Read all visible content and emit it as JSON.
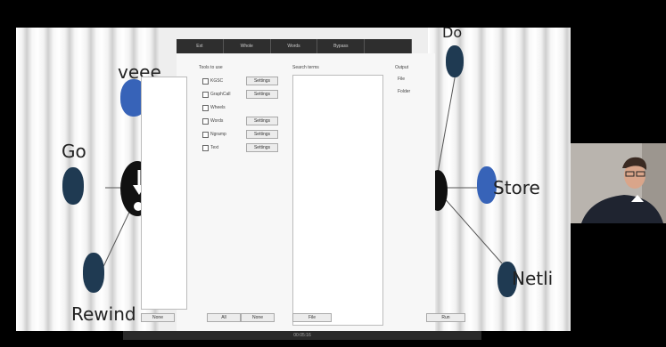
{
  "topbar_tabs": [
    "Ext",
    "Whole",
    "Words",
    "Bypass",
    ""
  ],
  "tools_header": "Tools to use",
  "tools": [
    {
      "name": "KGSC",
      "settings": "Settings"
    },
    {
      "name": "GraphCall",
      "settings": "Settings"
    },
    {
      "name": "Wheels",
      "settings": ""
    },
    {
      "name": "Words",
      "settings": "Settings"
    },
    {
      "name": "Ngramp",
      "settings": "Settings"
    },
    {
      "name": "Text",
      "settings": "Settings"
    }
  ],
  "search_header": "Search terms",
  "output_header": "Output",
  "output_labels": [
    "File",
    "Folder"
  ],
  "bottom_buttons": {
    "none_left": "None",
    "all": "All",
    "none_mid": "None",
    "file": "File",
    "run": "Run"
  },
  "mindmap_words": {
    "veee": "veee",
    "go": "Go",
    "rewind": "Rewind",
    "top": "Do",
    "store": "Store",
    "netli": "Netli",
    "question": "?"
  },
  "taskbar_text": "00:05:16",
  "colors": {
    "blue": "#3763b8",
    "navy": "#1f3a52",
    "dark": "#111111"
  }
}
